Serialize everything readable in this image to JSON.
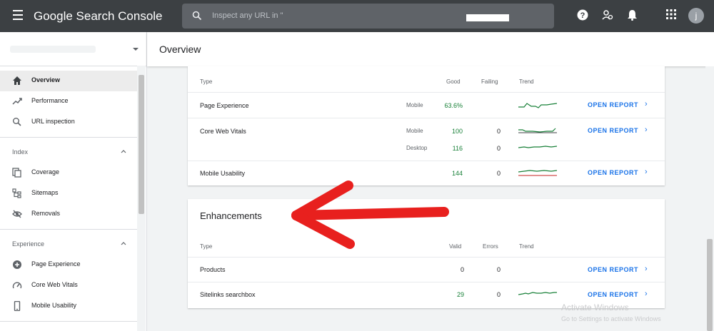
{
  "app": {
    "brand": "Google Search Console",
    "search_placeholder": "Inspect any URL in \"",
    "avatar_letter": "j"
  },
  "sidebar": {
    "items_top": [
      {
        "label": "Overview",
        "icon": "home-icon",
        "active": true
      },
      {
        "label": "Performance",
        "icon": "trending-up-icon"
      },
      {
        "label": "URL inspection",
        "icon": "search-icon"
      }
    ],
    "sections": [
      {
        "label": "Index",
        "items": [
          {
            "label": "Coverage",
            "icon": "copy-icon"
          },
          {
            "label": "Sitemaps",
            "icon": "sitemap-icon"
          },
          {
            "label": "Removals",
            "icon": "visibility-off-icon"
          }
        ]
      },
      {
        "label": "Experience",
        "items": [
          {
            "label": "Page Experience",
            "icon": "plus-circle-icon"
          },
          {
            "label": "Core Web Vitals",
            "icon": "speed-icon"
          },
          {
            "label": "Mobile Usability",
            "icon": "smartphone-icon"
          }
        ]
      }
    ]
  },
  "main": {
    "title": "Overview",
    "experience_card": {
      "headers": {
        "type": "Type",
        "good": "Good",
        "failing": "Failing",
        "trend": "Trend"
      },
      "rows": [
        {
          "type": "Page Experience",
          "sub": [
            {
              "device": "Mobile",
              "good": "63.6%",
              "failing": ""
            }
          ]
        },
        {
          "type": "Core Web Vitals",
          "sub": [
            {
              "device": "Mobile",
              "good": "100",
              "failing": "0"
            },
            {
              "device": "Desktop",
              "good": "116",
              "failing": "0"
            }
          ]
        },
        {
          "type": "Mobile Usability",
          "sub": [
            {
              "device": "",
              "good": "144",
              "failing": "0"
            }
          ]
        }
      ],
      "open_report": "OPEN REPORT"
    },
    "enhancements_card": {
      "title": "Enhancements",
      "headers": {
        "type": "Type",
        "valid": "Valid",
        "errors": "Errors",
        "trend": "Trend"
      },
      "rows": [
        {
          "type": "Products",
          "valid": "0",
          "errors": "0"
        },
        {
          "type": "Sitelinks searchbox",
          "valid": "29",
          "errors": "0"
        }
      ],
      "open_report": "OPEN REPORT"
    }
  },
  "watermark": {
    "line1": "Activate Windows",
    "line2": "Go to Settings to activate Windows"
  },
  "colors": {
    "topbar": "#3c4043",
    "accent": "#1a73e8",
    "good": "#188038",
    "annotation_arrow": "#e8201e"
  }
}
